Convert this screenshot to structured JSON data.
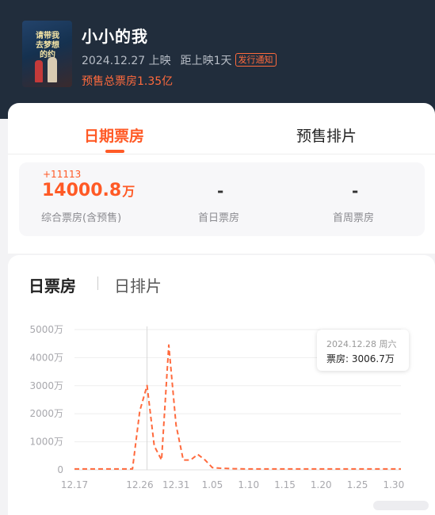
{
  "movie": {
    "title": "小小的我",
    "release_date": "2024.12.27 上映",
    "countdown": "距上映1天",
    "notify_badge": "发行通知",
    "presale_total": "预售总票房1.35亿",
    "poster_text": "请带我去梦想的约"
  },
  "tabs": [
    "日期票房",
    "预售排片"
  ],
  "stats": {
    "delta": "+11113",
    "total_value": "14000.8",
    "total_unit": "万",
    "total_label": "综合票房(含预售)",
    "first_day_value": "-",
    "first_day_label": "首日票房",
    "first_week_value": "-",
    "first_week_label": "首周票房"
  },
  "chart_tabs": [
    "日票房",
    "日排片"
  ],
  "tooltip": {
    "date": "2024.12.28 周六",
    "value": "票房: 3006.7万"
  },
  "chart_data": {
    "type": "line",
    "title": "",
    "xlabel": "",
    "ylabel": "",
    "ylim": [
      0,
      5000
    ],
    "ytick_labels": [
      "0",
      "1000万",
      "2000万",
      "3000万",
      "4000万",
      "5000万"
    ],
    "yticks": [
      0,
      1000,
      2000,
      3000,
      4000,
      5000
    ],
    "xtick_labels": [
      "12.17",
      "12.26",
      "12.31",
      "1.05",
      "1.10",
      "1.15",
      "1.20",
      "1.25",
      "1.30"
    ],
    "xtick_days": [
      0,
      9,
      14,
      19,
      24,
      29,
      34,
      39,
      44
    ],
    "x_days": [
      0,
      1,
      2,
      3,
      4,
      5,
      6,
      7,
      8,
      9,
      10,
      11,
      12,
      13,
      14,
      15,
      16,
      17,
      18,
      19,
      20,
      21,
      22,
      23,
      24,
      25,
      26,
      27,
      28,
      29,
      30,
      31,
      32,
      33,
      34,
      35,
      36,
      37,
      38,
      39,
      40,
      41,
      42,
      43,
      44,
      45
    ],
    "values": [
      30,
      30,
      30,
      30,
      30,
      30,
      30,
      30,
      30,
      2100,
      3006.7,
      850,
      350,
      4450,
      1600,
      350,
      350,
      550,
      350,
      80,
      60,
      50,
      40,
      35,
      30,
      30,
      30,
      30,
      30,
      30,
      30,
      30,
      30,
      30,
      30,
      30,
      30,
      30,
      30,
      30,
      30,
      30,
      30,
      30,
      30,
      30
    ],
    "highlight_day": 10,
    "line_color": "#ff6a3d",
    "line_style": "dashed",
    "grid": true
  }
}
